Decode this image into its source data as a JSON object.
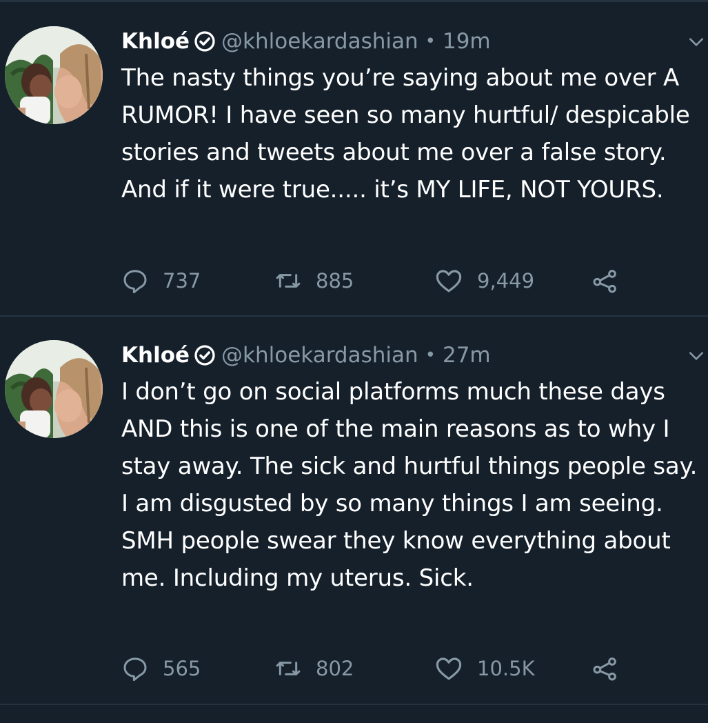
{
  "tweets": [
    {
      "name": "Khloé",
      "handle": "@khloekardashian",
      "separator": "•",
      "time": "19m",
      "text": "The nasty things you’re saying about me over A RUMOR! I have seen so many hurtful/ despicable stories and tweets about me over a false story. And if it were true..... it’s MY LIFE, NOT YOURS.",
      "replies": "737",
      "retweets": "885",
      "likes": "9,449"
    },
    {
      "name": "Khloé",
      "handle": "@khloekardashian",
      "separator": "•",
      "time": "27m",
      "text": "I don’t go on social platforms much these days AND this is one of the main reasons as to why I stay away. The sick and hurtful things people say. I am disgusted by so many things I am seeing. SMH people swear they know everything about me. Including my uterus. Sick.",
      "replies": "565",
      "retweets": "802",
      "likes": "10.5K"
    }
  ],
  "icons": {
    "reply": "reply-icon",
    "retweet": "retweet-icon",
    "like": "heart-icon",
    "share": "share-icon",
    "verified": "verified-badge-icon",
    "menu": "chevron-down-icon"
  },
  "colors": {
    "background": "#15202b",
    "text": "#ffffff",
    "secondary": "#8899a6",
    "divider": "#253341"
  }
}
